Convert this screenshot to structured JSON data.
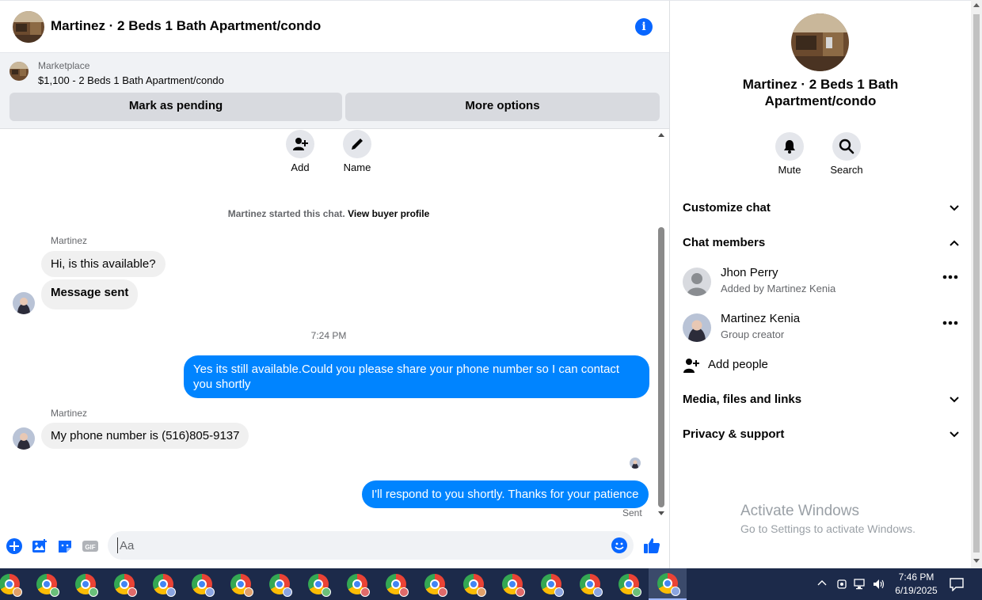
{
  "conversation": {
    "title": "Martinez · 2 Beds 1 Bath Apartment/condo",
    "listing": {
      "source": "Marketplace",
      "summary": "$1,100 - 2 Beds 1 Bath Apartment/condo",
      "mark_pending_label": "Mark as pending",
      "more_options_label": "More options"
    },
    "actions": {
      "add_label": "Add",
      "name_label": "Name"
    },
    "system_note": {
      "text": "Martinez started this chat. ",
      "link": "View buyer profile"
    },
    "messages": {
      "sender_1": "Martinez",
      "msg_1": "Hi, is this available?",
      "msg_2": "Message sent",
      "timestamp": "7:24 PM",
      "msg_3": "Yes its still available.Could you please share your phone number so I can contact you shortly",
      "sender_2": "Martinez",
      "msg_4": "My phone number is (516)805-9137",
      "msg_5": "I'll respond to you shortly. Thanks for your patience",
      "status": "Sent"
    },
    "composer": {
      "placeholder": "Aa"
    }
  },
  "details": {
    "title": "Martinez · 2 Beds 1 Bath Apartment/condo",
    "mute_label": "Mute",
    "search_label": "Search",
    "sections": {
      "customize": "Customize chat",
      "members": "Chat members",
      "media": "Media, files and links",
      "privacy": "Privacy & support"
    },
    "members": [
      {
        "name": "Jhon Perry",
        "subtitle": "Added by Martinez Kenia"
      },
      {
        "name": "Martinez Kenia",
        "subtitle": "Group creator"
      }
    ],
    "add_people_label": "Add people"
  },
  "watermark": {
    "line1": "Activate Windows",
    "line2": "Go to Settings to activate Windows."
  },
  "taskbar": {
    "time": "7:46 PM",
    "date": "6/19/2025"
  },
  "colors": {
    "accent": "#0866ff",
    "outgoing_bubble": "#0084ff",
    "incoming_bubble": "#f0f0f0",
    "taskbar": "#1c2a4a"
  }
}
